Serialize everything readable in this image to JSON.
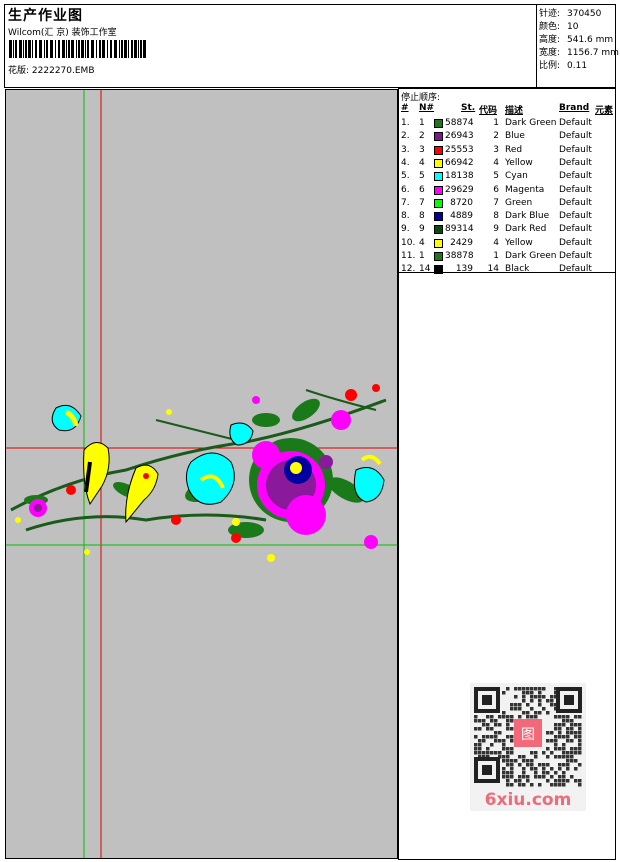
{
  "header": {
    "title": "生产作业图",
    "company": "Wilcom(汇 京) 装饰工作室",
    "design_label": "花版:",
    "design_file": "2222270.EMB"
  },
  "stats": [
    {
      "label": "针迹:",
      "value": "370450"
    },
    {
      "label": "颜色:",
      "value": "10"
    },
    {
      "label": "高度:",
      "value": "541.6 mm"
    },
    {
      "label": "宽度:",
      "value": "1156.7 mm"
    },
    {
      "label": "比例:",
      "value": "0.11"
    }
  ],
  "stop_sequence": {
    "title": "停止顺序:",
    "columns": [
      "#",
      "N#",
      "St.",
      "代码",
      "描述",
      "Brand",
      "元素"
    ],
    "rows": [
      {
        "idx": "1.",
        "n": "1",
        "color": "#1a7a1a",
        "st": "58874",
        "code": "1",
        "desc": "Dark Green",
        "brand": "Default"
      },
      {
        "idx": "2.",
        "n": "2",
        "color": "#7a1a8a",
        "st": "26943",
        "code": "2",
        "desc": "Blue",
        "brand": "Default"
      },
      {
        "idx": "3.",
        "n": "3",
        "color": "#ff0000",
        "st": "25553",
        "code": "3",
        "desc": "Red",
        "brand": "Default"
      },
      {
        "idx": "4.",
        "n": "4",
        "color": "#ffff00",
        "st": "66942",
        "code": "4",
        "desc": "Yellow",
        "brand": "Default"
      },
      {
        "idx": "5.",
        "n": "5",
        "color": "#00ffff",
        "st": "18138",
        "code": "5",
        "desc": "Cyan",
        "brand": "Default"
      },
      {
        "idx": "6.",
        "n": "6",
        "color": "#ff00ff",
        "st": "29629",
        "code": "6",
        "desc": "Magenta",
        "brand": "Default"
      },
      {
        "idx": "7.",
        "n": "7",
        "color": "#00ff00",
        "st": "8720",
        "code": "7",
        "desc": "Green",
        "brand": "Default"
      },
      {
        "idx": "8.",
        "n": "8",
        "color": "#0000a0",
        "st": "4889",
        "code": "8",
        "desc": "Dark Blue",
        "brand": "Default"
      },
      {
        "idx": "9.",
        "n": "9",
        "color": "#0a4a0a",
        "st": "89314",
        "code": "9",
        "desc": "Dark Red",
        "brand": "Default"
      },
      {
        "idx": "10.",
        "n": "4",
        "color": "#ffff00",
        "st": "2429",
        "code": "4",
        "desc": "Yellow",
        "brand": "Default"
      },
      {
        "idx": "11.",
        "n": "1",
        "color": "#1a7a1a",
        "st": "38878",
        "code": "1",
        "desc": "Dark Green",
        "brand": "Default"
      },
      {
        "idx": "12.",
        "n": "14",
        "color": "#000000",
        "st": "139",
        "code": "14",
        "desc": "Black",
        "brand": "Default"
      }
    ]
  },
  "watermark": {
    "text": "6xiu.com",
    "seal": "图"
  }
}
